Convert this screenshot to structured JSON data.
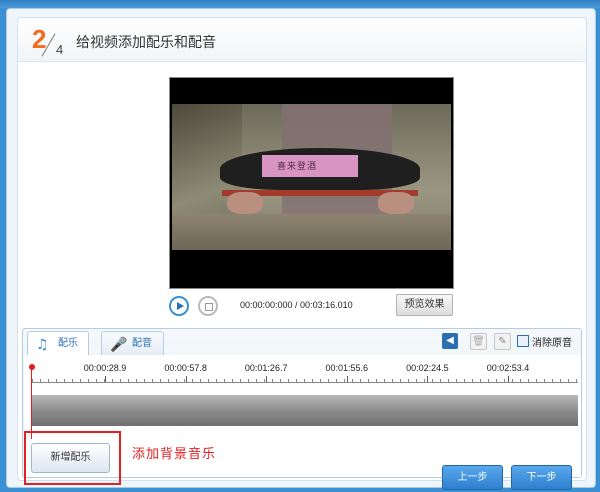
{
  "header": {
    "step_current": "2",
    "step_total": "4",
    "title": "给视频添加配乐和配音"
  },
  "video": {
    "overlay_text": "喜来登酒"
  },
  "player": {
    "time_readout": "00:00:00:000 / 00:03:16.010",
    "preview_label": "预览效果",
    "play_icon": "play-icon",
    "stop_icon": "stop-icon"
  },
  "tabs": {
    "music_label": "配乐",
    "dub_label": "配音",
    "music_icon": "music-note-icon",
    "dub_icon": "microphone-icon"
  },
  "toolbar": {
    "mute_label": "消除原音",
    "mute_checked": false
  },
  "timeline": {
    "tick_labels": [
      "00:00:28.9",
      "00:00:57.8",
      "00:01:26.7",
      "00:01:55.6",
      "00:02:24.5",
      "00:02:53.4"
    ]
  },
  "actions": {
    "add_music_label": "新增配乐",
    "annotation": "添加背景音乐",
    "prev_label": "上一步",
    "next_label": "下一步"
  },
  "colors": {
    "step_accent": "#f26b1d",
    "playhead": "#e02020",
    "highlight": "#e52020",
    "primary": "#2d7fcf"
  }
}
